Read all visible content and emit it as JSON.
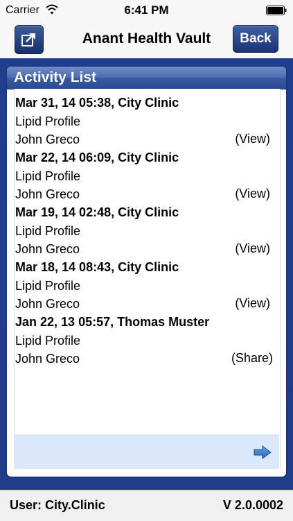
{
  "status_bar": {
    "carrier": "Carrier",
    "time": "6:41 PM"
  },
  "nav": {
    "title": "Anant Health Vault",
    "back_label": "Back",
    "share_icon": "share-icon"
  },
  "panel": {
    "title": "Activity List"
  },
  "activities": [
    {
      "header": "Mar 31, 14 05:38, City Clinic",
      "test": "Lipid Profile",
      "person": "John Greco",
      "action": "(View)"
    },
    {
      "header": "Mar 22, 14 06:09, City Clinic",
      "test": "Lipid Profile",
      "person": "John Greco",
      "action": "(View)"
    },
    {
      "header": "Mar 19, 14 02:48, City Clinic",
      "test": "Lipid Profile",
      "person": "John Greco",
      "action": "(View)"
    },
    {
      "header": "Mar 18, 14 08:43, City Clinic",
      "test": "Lipid Profile",
      "person": "John Greco",
      "action": "(View)"
    },
    {
      "header": "Jan 22, 13 05:57, Thomas Muster",
      "test": "Lipid Profile",
      "person": "John Greco",
      "action": "(Share)"
    }
  ],
  "footer": {
    "user": "User: City.Clinic",
    "version": "V 2.0.0002"
  },
  "colors": {
    "navy": "#1f3e8e",
    "button": "#1a3377",
    "footer_box": "#dbe7fb",
    "arrow": "#3a78c8"
  }
}
